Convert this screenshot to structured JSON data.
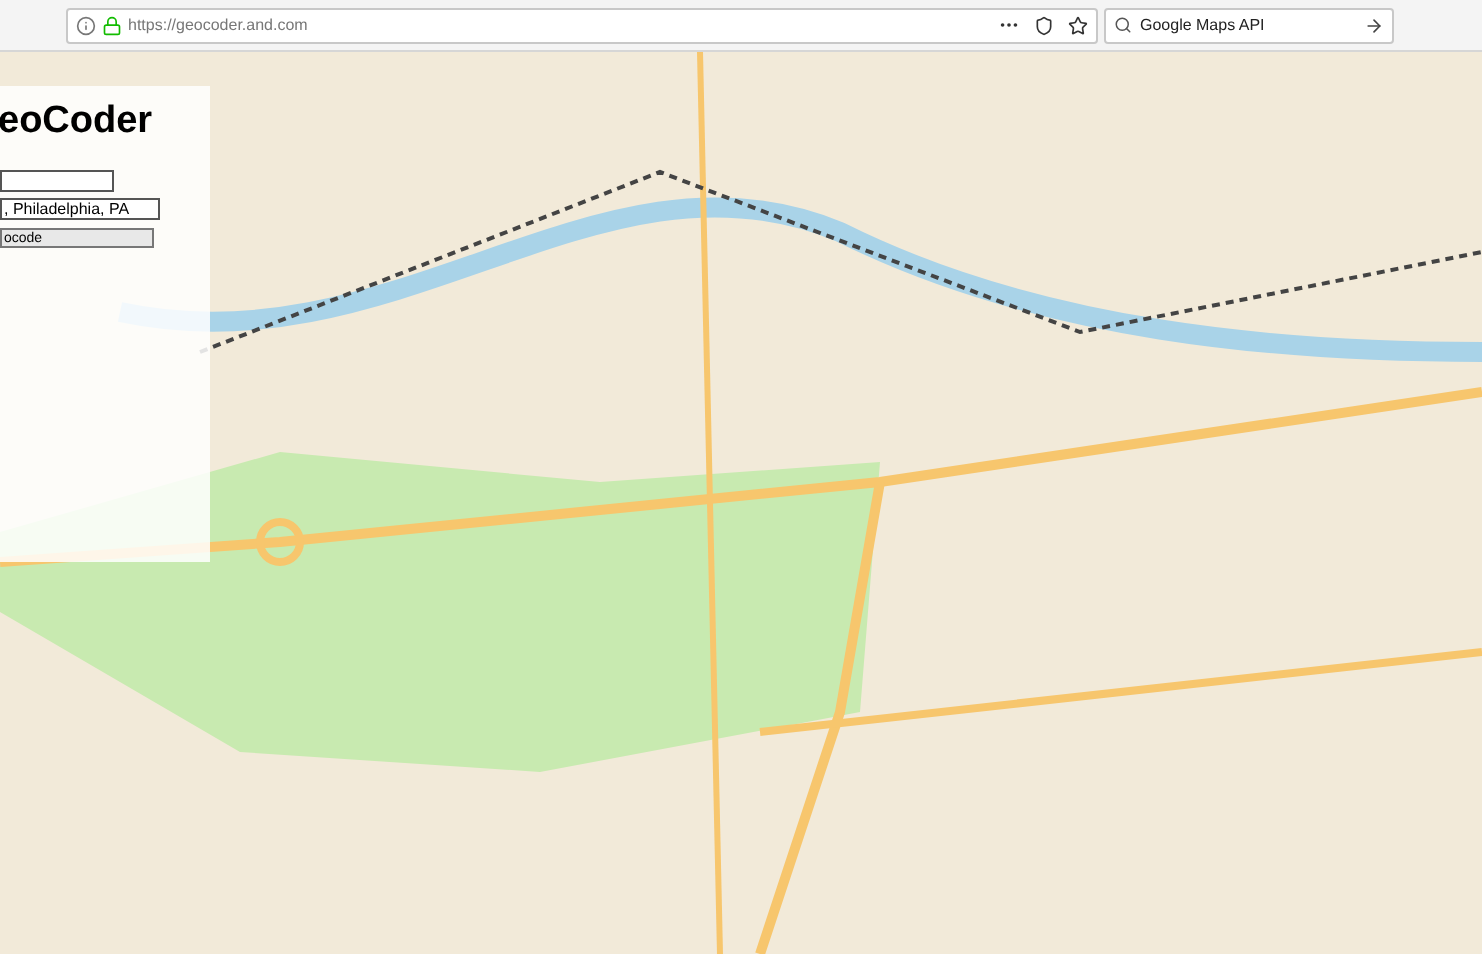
{
  "browser": {
    "url": "https://geocoder.and.com",
    "search": {
      "value": "Google Maps API"
    }
  },
  "panel": {
    "title": "eoCoder",
    "fields": [
      {
        "kind": "short"
      },
      {
        "kind": "wide",
        "value": ", Philadelphia, PA"
      }
    ],
    "button": "ocode"
  }
}
